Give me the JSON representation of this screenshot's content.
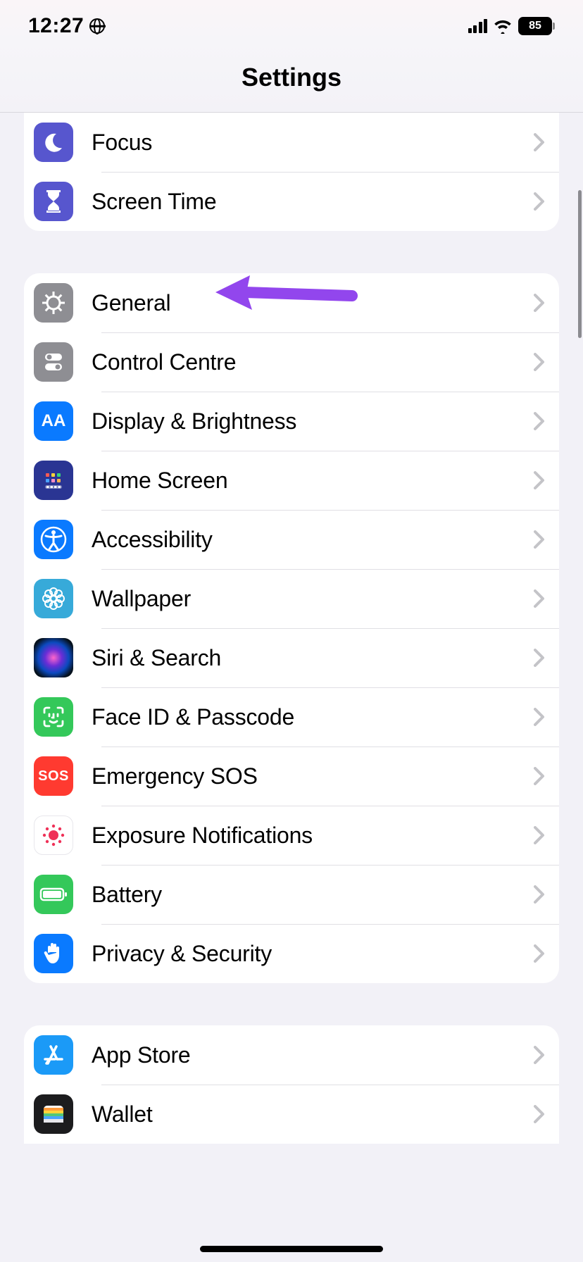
{
  "status": {
    "time": "12:27",
    "battery_pct": "85"
  },
  "header": {
    "title": "Settings"
  },
  "groups": [
    {
      "items": [
        {
          "id": "focus",
          "label": "Focus"
        },
        {
          "id": "screentime",
          "label": "Screen Time"
        }
      ]
    },
    {
      "items": [
        {
          "id": "general",
          "label": "General"
        },
        {
          "id": "control",
          "label": "Control Centre"
        },
        {
          "id": "display",
          "label": "Display & Brightness"
        },
        {
          "id": "home",
          "label": "Home Screen"
        },
        {
          "id": "access",
          "label": "Accessibility"
        },
        {
          "id": "wallpaper",
          "label": "Wallpaper"
        },
        {
          "id": "siri",
          "label": "Siri & Search"
        },
        {
          "id": "faceid",
          "label": "Face ID & Passcode"
        },
        {
          "id": "sos",
          "label": "Emergency SOS"
        },
        {
          "id": "exposure",
          "label": "Exposure Notifications"
        },
        {
          "id": "battery",
          "label": "Battery"
        },
        {
          "id": "privacy",
          "label": "Privacy & Security"
        }
      ]
    },
    {
      "items": [
        {
          "id": "appstore",
          "label": "App Store"
        },
        {
          "id": "wallet",
          "label": "Wallet"
        }
      ]
    }
  ],
  "icon_text": {
    "sos": "SOS",
    "display": "AA"
  },
  "annotation": {
    "arrow_color": "#9246ed"
  }
}
